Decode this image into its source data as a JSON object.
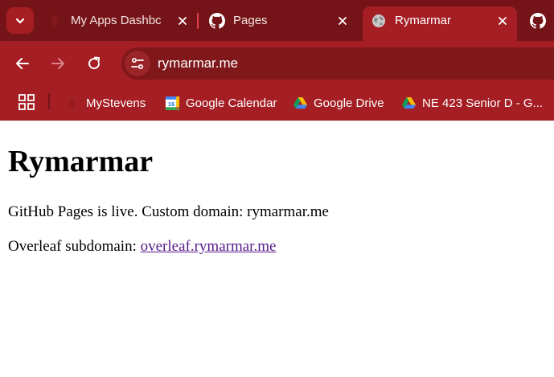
{
  "tabs": [
    {
      "title": "My Apps Dashbc",
      "favicon": "stevens-icon",
      "active": false
    },
    {
      "title": "Pages",
      "favicon": "github-icon",
      "active": false
    },
    {
      "title": "Rymarmar",
      "favicon": "globe-icon",
      "active": true
    }
  ],
  "omnibox": {
    "url": "rymarmar.me"
  },
  "bookmarks": [
    {
      "label": "MyStevens",
      "icon": "stevens-icon"
    },
    {
      "label": "Google Calendar",
      "icon": "google-calendar-icon",
      "badge": "16"
    },
    {
      "label": "Google Drive",
      "icon": "google-drive-icon"
    },
    {
      "label": "NE 423 Senior D - G...",
      "icon": "google-drive-icon"
    }
  ],
  "page": {
    "heading": "Rymarmar",
    "line1": "GitHub Pages is live. Custom domain: rymarmar.me",
    "line2_prefix": "Overleaf subdomain: ",
    "line2_link": "overleaf.rymarmar.me"
  },
  "colors": {
    "tabstrip": "#751418",
    "toolbar": "#a51e24",
    "omnibox": "#7f171b",
    "link": "#551a8b"
  }
}
